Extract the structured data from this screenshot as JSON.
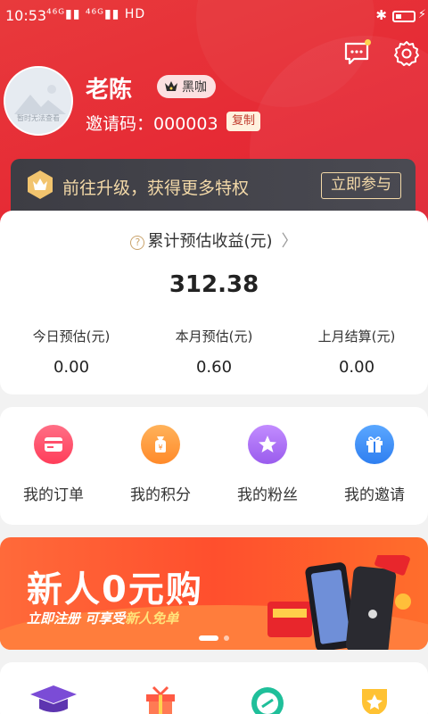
{
  "status_bar": {
    "time": "10:53",
    "signal": "⁴⁶ᴳ▮▮ ⁴⁶ᴳ▮▮ HD",
    "bluetooth": "✱"
  },
  "header": {
    "message_icon": "chat-bubble-icon",
    "settings_icon": "gear-icon"
  },
  "profile": {
    "avatar_caption": "暂时无法查看",
    "name": "老陈",
    "level_badge": "黑咖",
    "invite_label": "邀请码：",
    "invite_code": "000003",
    "copy_label": "复制"
  },
  "vip": {
    "text": "前往升级，获得更多特权",
    "button": "立即参与"
  },
  "earnings": {
    "title": "累计预估收益(元)",
    "total": "312.38",
    "columns": [
      {
        "label": "今日预估(元)",
        "value": "0.00"
      },
      {
        "label": "本月预估(元)",
        "value": "0.60"
      },
      {
        "label": "上月结算(元)",
        "value": "0.00"
      }
    ]
  },
  "menu": [
    {
      "label": "我的订单",
      "icon": "order-icon",
      "color": "#ff4f6a"
    },
    {
      "label": "我的积分",
      "icon": "points-bag-icon",
      "color": "#ff9b3d"
    },
    {
      "label": "我的粉丝",
      "icon": "star-icon",
      "color": "#a66cf0"
    },
    {
      "label": "我的邀请",
      "icon": "gift-icon",
      "color": "#3d8ef5"
    }
  ],
  "banner": {
    "title": "新人0元购",
    "subtitle_prefix": "立即注册  可享受",
    "subtitle_highlight": "新人免单"
  },
  "bottom_icons": [
    "graduation-cap-icon",
    "gift-box-icon",
    "link-icon",
    "badge-icon"
  ]
}
